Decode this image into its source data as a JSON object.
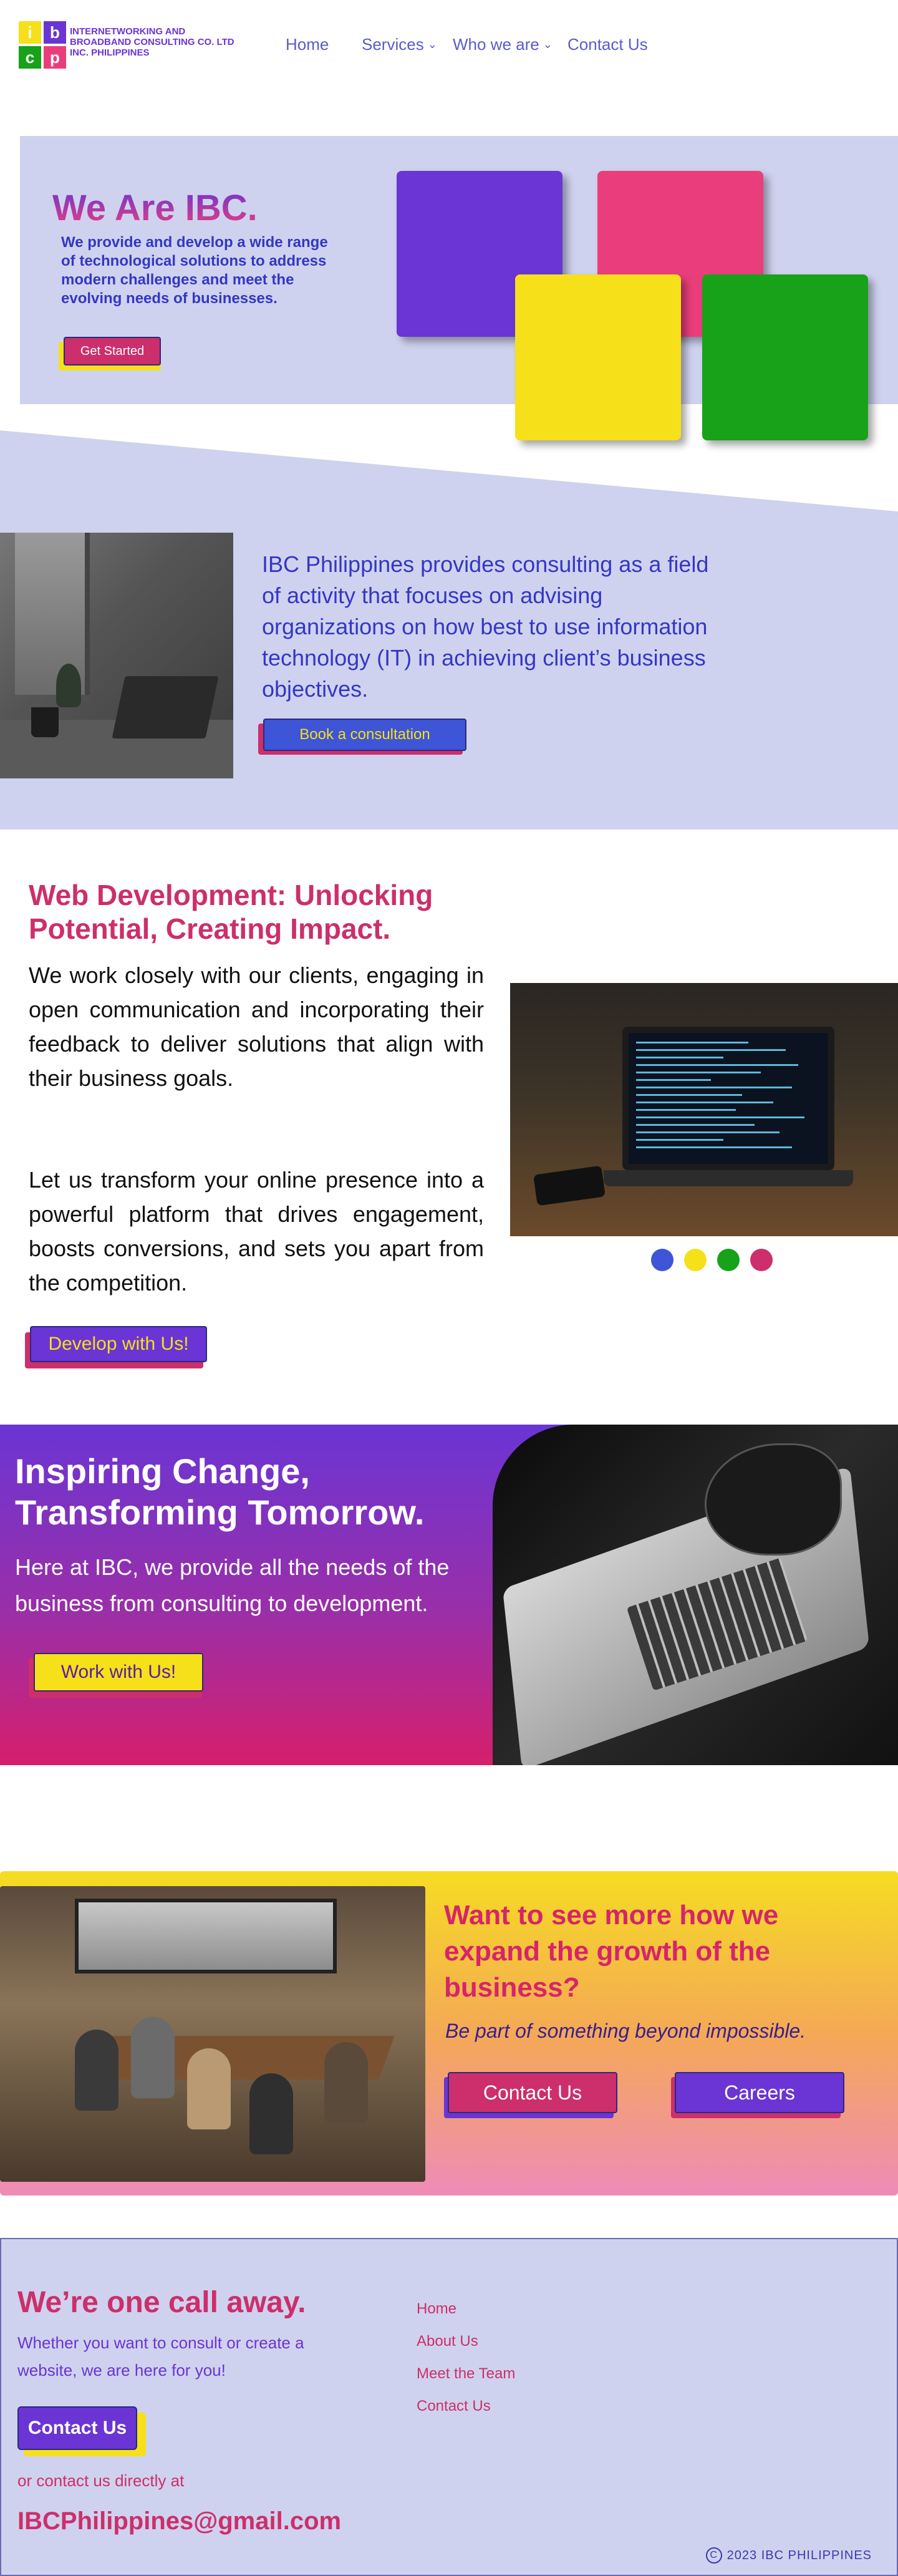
{
  "header": {
    "logo_letters": [
      "i",
      "b",
      "c",
      "p"
    ],
    "company_name": "INTERNETWORKING AND BROADBAND CONSULTING CO. LTD INC. PHILIPPINES",
    "nav": [
      {
        "label": "Home"
      },
      {
        "label": "Services",
        "icon": "chevron-down-icon"
      },
      {
        "label": "Who we are",
        "icon": "chevron-down-icon"
      },
      {
        "label": "Contact Us"
      }
    ]
  },
  "hero": {
    "title": "We Are IBC.",
    "text": "We provide and develop a wide range of technological solutions to address modern challenges and meet the evolving needs of businesses.",
    "button": "Get Started",
    "colors": {
      "purple": "#6a35d4",
      "pink": "#ea3e7c",
      "yellow": "#f6e01a",
      "green": "#17a21a"
    }
  },
  "consult": {
    "text": "IBC Philippines provides consulting as a field of activity that focuses on advising organizations on how best to use information technology (IT) in achieving client’s business objectives.",
    "button": "Book a consultation"
  },
  "webdev": {
    "title": "Web Development: Unlocking Potential, Creating Impact.",
    "p1": "We work closely with our clients, engaging in open communication and incorporating their feedback to deliver solutions that align with their business goals.",
    "p2": "Let us transform your online presence into a powerful platform that drives engagement, boosts conversions, and sets you apart from the competition.",
    "button": "Develop with Us!",
    "dots": [
      "#3d55d6",
      "#f6e01a",
      "#17a21a",
      "#cc2f6b"
    ]
  },
  "inspiring": {
    "title": "Inspiring Change, Transforming Tomorrow.",
    "text": "Here at IBC, we provide all the needs of the business from consulting to development.",
    "button": "Work with Us!"
  },
  "growth": {
    "title": "Want to see more how we expand the growth of the business?",
    "subtitle": "Be part of something beyond impossible.",
    "contact_button": "Contact Us",
    "careers_button": "Careers"
  },
  "footer": {
    "title": "We’re one call away.",
    "text": "Whether you want to consult or create a website, we are here for you!",
    "button": "Contact Us",
    "or_text": "or contact us directly at",
    "email": "IBCPhilippines@gmail.com",
    "links": [
      "Home",
      "About Us",
      "Meet the Team",
      "Contact Us"
    ],
    "copyright_symbol": "C",
    "copyright": "2023 IBC PHILIPPINES"
  }
}
